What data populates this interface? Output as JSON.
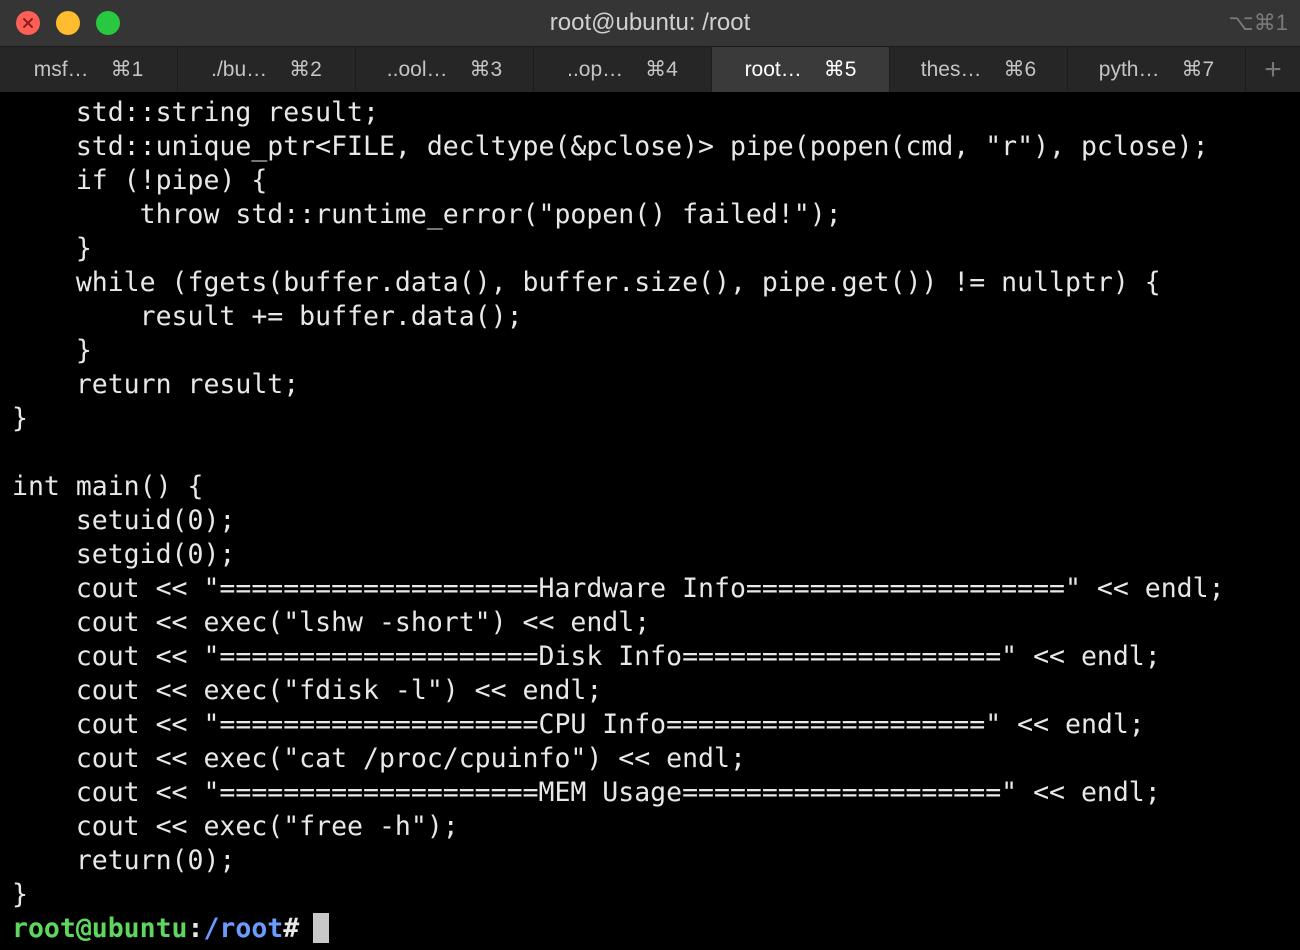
{
  "window": {
    "title": "root@ubuntu: /root",
    "shortcut": "⌥⌘1"
  },
  "tabs": [
    {
      "label": "msf…",
      "key": "⌘1",
      "active": false
    },
    {
      "label": "./bu…",
      "key": "⌘2",
      "active": false
    },
    {
      "label": "..ool…",
      "key": "⌘3",
      "active": false
    },
    {
      "label": "..op…",
      "key": "⌘4",
      "active": false
    },
    {
      "label": "root…",
      "key": "⌘5",
      "active": true
    },
    {
      "label": "thes…",
      "key": "⌘6",
      "active": false
    },
    {
      "label": "pyth…",
      "key": "⌘7",
      "active": false
    }
  ],
  "new_tab": "+",
  "terminal": {
    "lines": [
      "    std::string result;",
      "    std::unique_ptr<FILE, decltype(&pclose)> pipe(popen(cmd, \"r\"), pclose);",
      "    if (!pipe) {",
      "        throw std::runtime_error(\"popen() failed!\");",
      "    }",
      "    while (fgets(buffer.data(), buffer.size(), pipe.get()) != nullptr) {",
      "        result += buffer.data();",
      "    }",
      "    return result;",
      "}",
      "",
      "int main() {",
      "    setuid(0);",
      "    setgid(0);",
      "    cout << \"====================Hardware Info====================\" << endl;",
      "    cout << exec(\"lshw -short\") << endl;",
      "    cout << \"====================Disk Info====================\" << endl;",
      "    cout << exec(\"fdisk -l\") << endl;",
      "    cout << \"====================CPU Info====================\" << endl;",
      "    cout << exec(\"cat /proc/cpuinfo\") << endl;",
      "    cout << \"====================MEM Usage====================\" << endl;",
      "    cout << exec(\"free -h\");",
      "    return(0);",
      "}"
    ],
    "prompt": {
      "user_host": "root@ubuntu",
      "colon": ":",
      "path": "/root",
      "symbol": "#"
    }
  }
}
